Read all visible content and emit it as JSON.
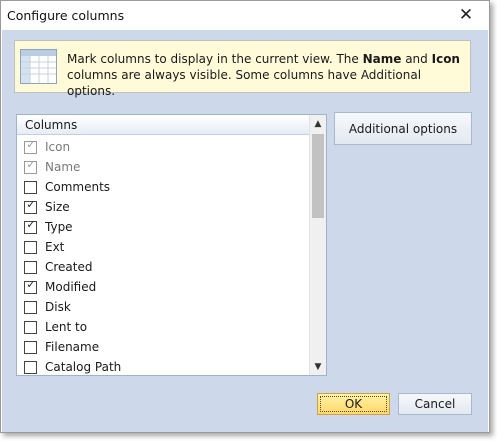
{
  "window": {
    "title": "Configure columns",
    "close_glyph": "✕"
  },
  "info": {
    "icon": "table-columns-icon",
    "text_part1": "Mark columns to display in the current view. The ",
    "name_bold": "Name",
    "text_part2": " and ",
    "icon_bold": "Icon",
    "text_part3": " columns are always visible. Some columns have Additional options."
  },
  "columns_list": {
    "header": "Columns",
    "items": [
      {
        "label": "Icon",
        "checked": true,
        "disabled": true
      },
      {
        "label": "Name",
        "checked": true,
        "disabled": true
      },
      {
        "label": "Comments",
        "checked": false,
        "disabled": false
      },
      {
        "label": "Size",
        "checked": true,
        "disabled": false
      },
      {
        "label": "Type",
        "checked": true,
        "disabled": false
      },
      {
        "label": "Ext",
        "checked": false,
        "disabled": false
      },
      {
        "label": "Created",
        "checked": false,
        "disabled": false
      },
      {
        "label": "Modified",
        "checked": true,
        "disabled": false
      },
      {
        "label": "Disk",
        "checked": false,
        "disabled": false
      },
      {
        "label": "Lent to",
        "checked": false,
        "disabled": false
      },
      {
        "label": "Filename",
        "checked": false,
        "disabled": false
      },
      {
        "label": "Catalog Path",
        "checked": false,
        "disabled": false
      }
    ],
    "scroll_up_glyph": "▲",
    "scroll_down_glyph": "▼"
  },
  "buttons": {
    "additional_options": "Additional options",
    "ok": "OK",
    "cancel": "Cancel"
  },
  "colors": {
    "client_bg": "#cdd9ea",
    "info_bg": "#fffbd9",
    "ok_bg": "#ffd867"
  }
}
